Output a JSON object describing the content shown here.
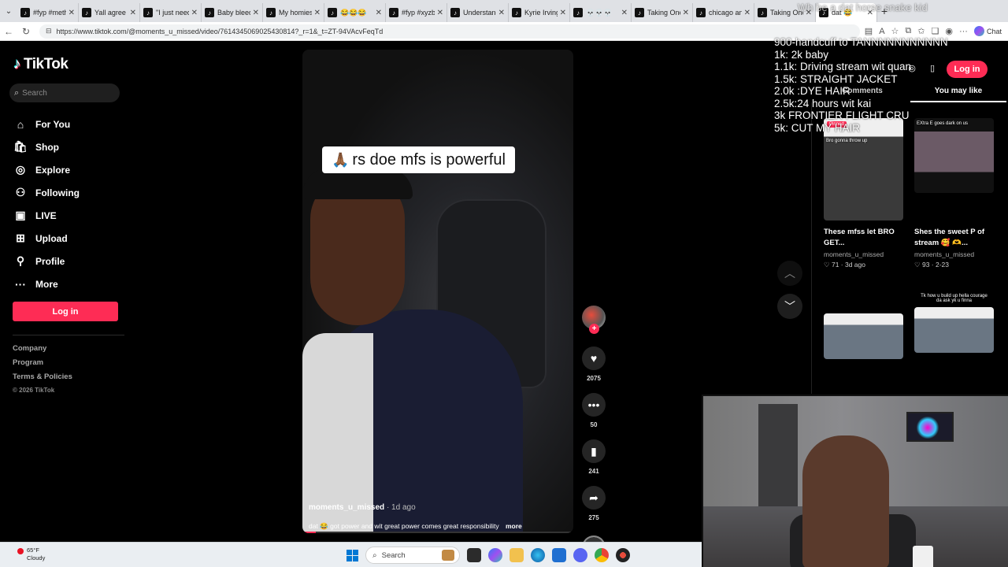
{
  "browser": {
    "tabs": [
      {
        "title": "#fyp #meth"
      },
      {
        "title": "Yall agree"
      },
      {
        "title": "\"I just need"
      },
      {
        "title": "Baby bleed"
      },
      {
        "title": "My homies"
      },
      {
        "title": "😂😂😂"
      },
      {
        "title": "#fyp #xyzb"
      },
      {
        "title": "Understand"
      },
      {
        "title": "Kyrie Irving"
      },
      {
        "title": "💀💀💀"
      },
      {
        "title": "Taking One"
      },
      {
        "title": "chicago an"
      },
      {
        "title": "Taking One"
      },
      {
        "title": "dat 😂"
      }
    ],
    "url": "https://www.tiktok.com/@moments_u_missed/video/7614345069025430814?_r=1&_t=ZT-94VAcvFeqTd",
    "chat_label": "Chat"
  },
  "sidebar": {
    "brand": "TikTok",
    "search_placeholder": "Search",
    "items": [
      {
        "label": "For You",
        "icon": "home-icon"
      },
      {
        "label": "Shop",
        "icon": "shop-bag-icon"
      },
      {
        "label": "Explore",
        "icon": "compass-icon"
      },
      {
        "label": "Following",
        "icon": "following-users-icon"
      },
      {
        "label": "LIVE",
        "icon": "live-tv-icon"
      },
      {
        "label": "Upload",
        "icon": "upload-plus-icon"
      },
      {
        "label": "Profile",
        "icon": "person-icon"
      },
      {
        "label": "More",
        "icon": "more-dots-icon"
      }
    ],
    "login_label": "Log in",
    "footer": [
      "Company",
      "Program",
      "Terms & Policies"
    ],
    "copyright": "© 2026 TikTok"
  },
  "video": {
    "caption": "rs doe mfs is powerful",
    "author": "moments_u_missed",
    "age": "· 1d ago",
    "description": "dat 😂 got power and wit great power comes great responsibility",
    "more_label": "more",
    "progress": 0.05,
    "likes": "2075",
    "comments": "50",
    "saves": "241",
    "shares": "275"
  },
  "overlay": {
    "ghost_text": "Wh be a dat horse snake kid",
    "lines": [
      "900-handcuff to TANNNNNNNNNNN",
      "1k: 2k baby",
      "1.1k: Driving stream wit quan",
      "1.5k: STRAIGHT JACKET",
      "2.0k :DYE HAIR",
      "2.5k:24 hours wit kai",
      "3k FRONTIER FLIGHT CRU",
      "5k: CUT MY HAIR"
    ]
  },
  "right_panel": {
    "login_label": "Log in",
    "tabs": [
      "Comments",
      "You may like"
    ],
    "cards": [
      {
        "title": "These mfss let BRO GET...",
        "author": "moments_u_missed",
        "stats": "♡ 71 · 3d ago",
        "badge": "Pinned",
        "thumb_text": "Bro gonna throw up"
      },
      {
        "title": "Shes the sweet P of stream 🥰 🫶...",
        "author": "moments_u_missed",
        "stats": "♡ 93 · 2-23",
        "badge": "",
        "thumb_text": "EXtra E goes dark on us"
      },
      {
        "title": "",
        "author": "",
        "stats": "",
        "badge": "",
        "thumb_text": ""
      },
      {
        "title": "",
        "author": "",
        "stats": "",
        "badge": "",
        "thumb_text": "Tk how u build up hella courage da ask yk u finna"
      }
    ]
  },
  "taskbar": {
    "temp": "65°F",
    "condition": "Cloudy",
    "search_label": "Search"
  }
}
